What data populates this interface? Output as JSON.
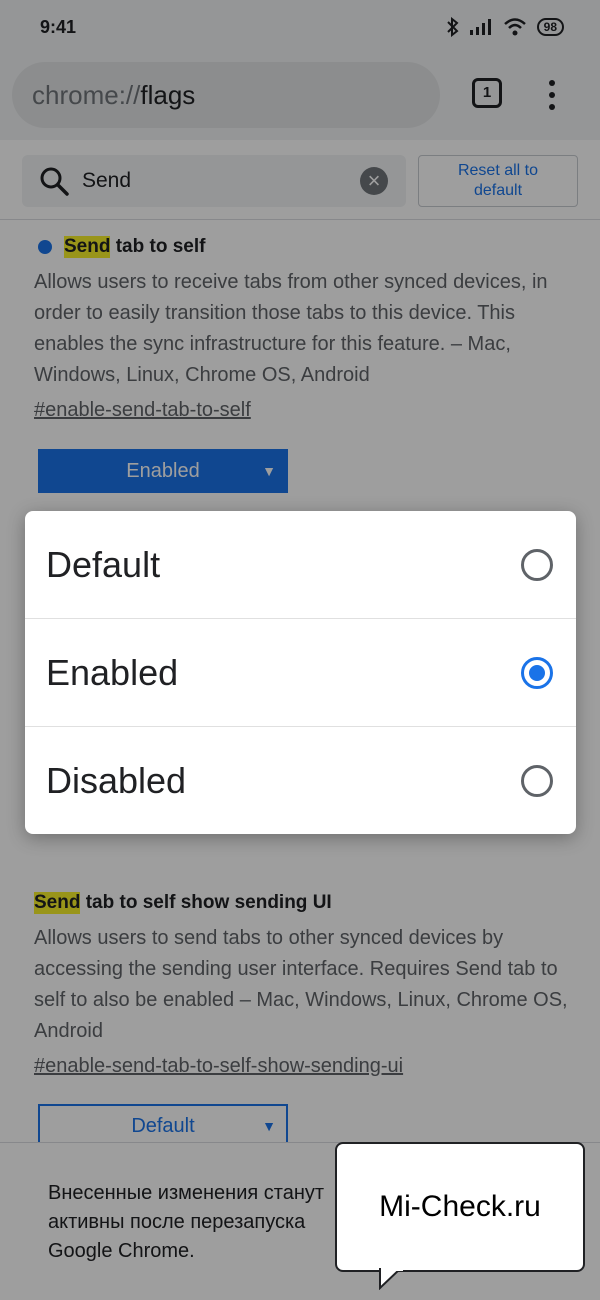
{
  "status": {
    "time": "9:41",
    "battery": "98"
  },
  "omnibox": {
    "scheme": "chrome://",
    "path": "flags"
  },
  "toolbar": {
    "tab_count": "1"
  },
  "search": {
    "query": "Send",
    "clear_glyph": "×",
    "reset_label_line1": "Reset all to",
    "reset_label_line2": "default"
  },
  "flag1": {
    "title_highlight": "Send",
    "title_rest": " tab to self",
    "description": "Allows users to receive tabs from other synced devices, in order to easily transition those tabs to this device. This enables the sync infrastructure for this feature. – Mac, Windows, Linux, Chrome OS, Android",
    "link": "#enable-send-tab-to-self",
    "selected": "Enabled"
  },
  "flag2": {
    "title_highlight": "Send",
    "title_rest": " tab to self show sending UI",
    "description": "Allows users to send tabs to other synced devices by accessing the sending user interface. Requires Send tab to self to also be enabled – Mac, Windows, Linux, Chrome OS, Android",
    "link": "#enable-send-tab-to-self-show-sending-ui",
    "selected": "Default"
  },
  "dropdown_arrow": "▼",
  "relaunch": {
    "text": "Внесенные изменения станут активны после перезапуска Google Chrome."
  },
  "dialog": {
    "options": [
      {
        "label": "Default",
        "checked": false
      },
      {
        "label": "Enabled",
        "checked": true
      },
      {
        "label": "Disabled",
        "checked": false
      }
    ]
  },
  "watermark": {
    "text": "Mi-Check.ru"
  },
  "colors": {
    "accent": "#1a73e8",
    "highlight": "#f7f12a",
    "scrim": "rgba(0,0,0,0.38)"
  },
  "icons": [
    "bluetooth-icon",
    "signal-icon",
    "wifi-icon",
    "battery-icon",
    "search-icon",
    "clear-icon",
    "tab-switcher-icon",
    "overflow-menu-icon"
  ]
}
